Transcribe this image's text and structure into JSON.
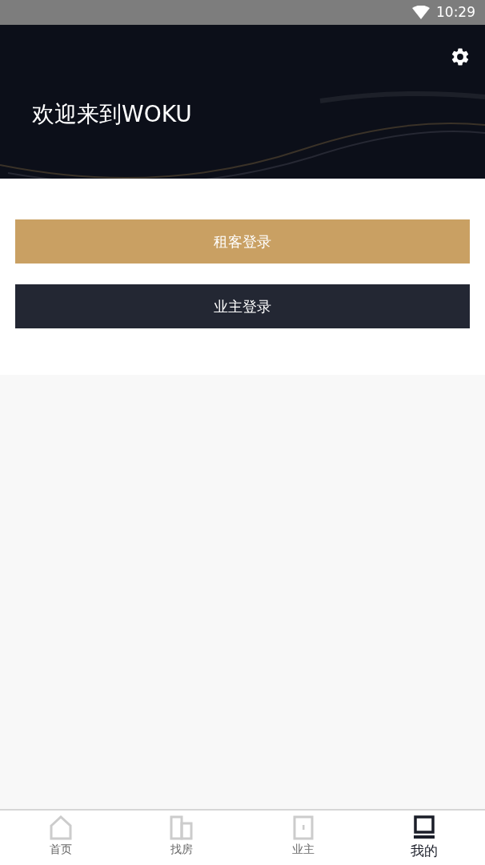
{
  "status_bar": {
    "time": "10:29"
  },
  "header": {
    "title": "欢迎来到WOKU"
  },
  "buttons": [
    {
      "label": "租客登录",
      "kind": "primary"
    },
    {
      "label": "业主登录",
      "kind": "secondary"
    }
  ],
  "tab_bar": [
    {
      "label": "首页",
      "kind": "home",
      "selected": false
    },
    {
      "label": "找房",
      "kind": "buildings",
      "selected": false
    },
    {
      "label": "业主",
      "kind": "door",
      "selected": false
    },
    {
      "label": "我的",
      "kind": "monitor",
      "selected": true
    }
  ]
}
